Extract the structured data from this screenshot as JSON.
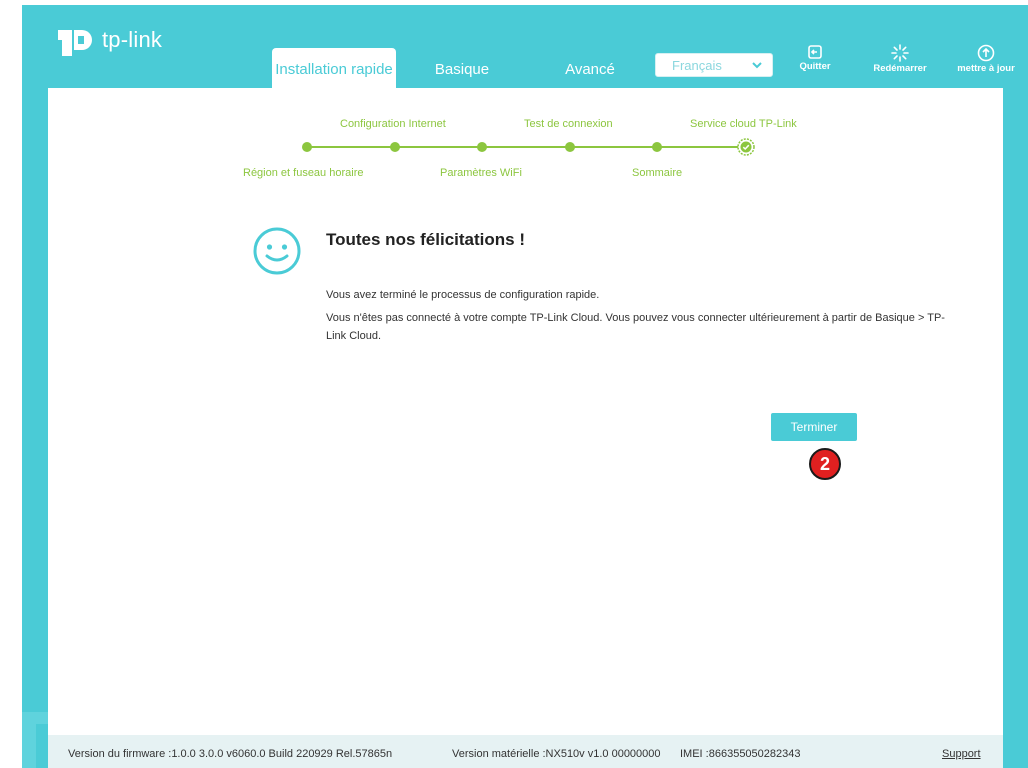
{
  "header": {
    "logo_text": "tp-link",
    "tabs": [
      {
        "label": "Installation rapide"
      },
      {
        "label": "Basique"
      },
      {
        "label": "Avancé"
      }
    ],
    "language": {
      "selected": "Français"
    },
    "buttons": {
      "quit": "Quitter",
      "reboot": "Redémarrer",
      "update": "mettre à jour"
    }
  },
  "stepper": {
    "top_labels": [
      "Configuration Internet",
      "Test de connexion",
      "Service cloud TP-Link"
    ],
    "bottom_labels": [
      "Région et fuseau horaire",
      "Paramètres WiFi",
      "Sommaire"
    ]
  },
  "content": {
    "title": "Toutes nos félicitations !",
    "line1": "Vous avez terminé le processus de configuration rapide.",
    "line2": "Vous n'êtes pas connecté à votre compte TP-Link Cloud. Vous pouvez vous connecter ultérieurement à partir de Basique > TP-Link Cloud.",
    "finish_label": "Terminer",
    "badge": "2"
  },
  "footer": {
    "firmware": "Version du firmware :1.0.0 3.0.0 v6060.0 Build 220929 Rel.57865n",
    "hardware": "Version matérielle :NX510v v1.0 00000000",
    "imei": "IMEI :866355050282343",
    "support": "Support"
  },
  "colors": {
    "accent": "#4acbd6",
    "step": "#8cc63f",
    "badge": "#e02020"
  }
}
